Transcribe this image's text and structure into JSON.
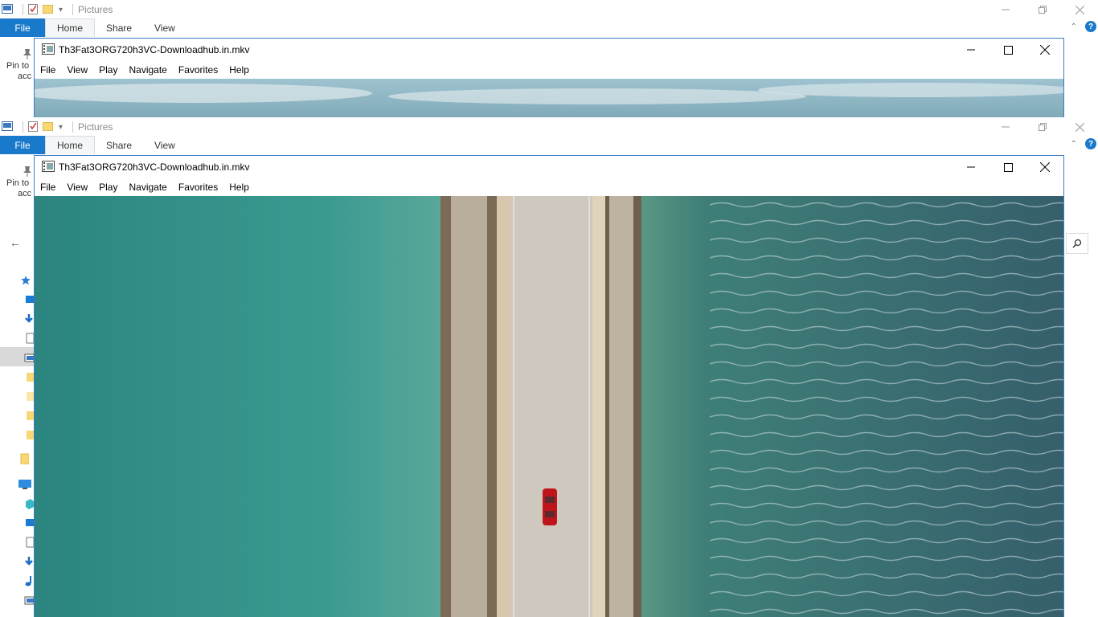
{
  "explorer": {
    "title": "Pictures",
    "tabs": [
      {
        "label": "File"
      },
      {
        "label": "Home"
      },
      {
        "label": "Share"
      },
      {
        "label": "View"
      }
    ],
    "pin_label_line1": "Pin to",
    "pin_label_line2": "acc",
    "help_label": "?"
  },
  "player": {
    "title": "Th3Fat3ORG720h3VC-Downloadhub.in.mkv",
    "menu": [
      "File",
      "View",
      "Play",
      "Navigate",
      "Favorites",
      "Help"
    ]
  },
  "colors": {
    "accent": "#1979ca",
    "window_border": "#3b7cc7",
    "sea_left": "#2f8a86",
    "sea_right": "#3a6e78",
    "road": "#cfc8bf",
    "car": "#c0141c"
  }
}
